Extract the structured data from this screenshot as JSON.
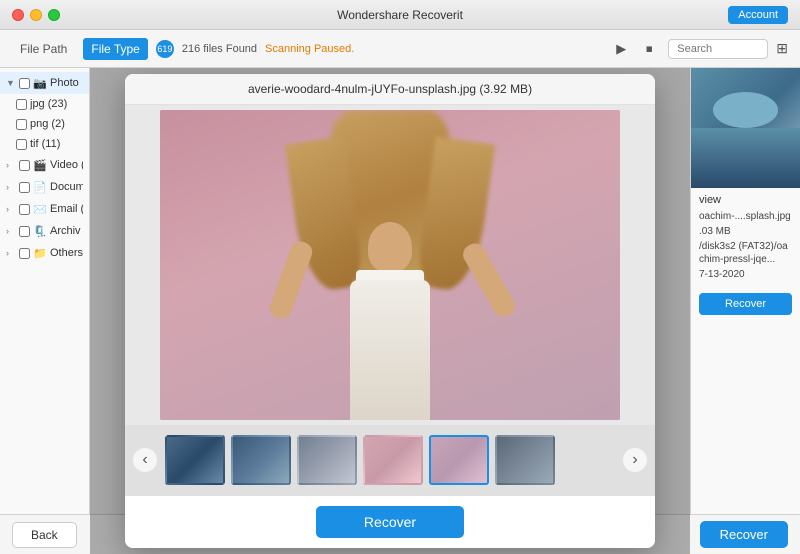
{
  "app": {
    "title": "Wondershare Recoverit",
    "account_label": "Account"
  },
  "toolbar": {
    "file_path_label": "File Path",
    "file_type_label": "File Type",
    "scan_count": "619",
    "files_found": "216 files Found",
    "scanning_status": "Scanning Paused.",
    "search_placeholder": "Search"
  },
  "sidebar": {
    "items": [
      {
        "label": "Photo",
        "expanded": true,
        "checked": false,
        "icon": "📷"
      },
      {
        "label": "jpg (23)",
        "sub": true,
        "checked": false
      },
      {
        "label": "png (2)",
        "sub": true,
        "checked": false
      },
      {
        "label": "tif (11)",
        "sub": true,
        "checked": false
      },
      {
        "label": "Video (",
        "checked": false,
        "icon": "🎬"
      },
      {
        "label": "Docum",
        "checked": false,
        "icon": "📄"
      },
      {
        "label": "Email (",
        "checked": false,
        "icon": "✉️"
      },
      {
        "label": "Archiv",
        "checked": false,
        "icon": "🗜️"
      },
      {
        "label": "Others",
        "checked": false,
        "icon": "📁"
      }
    ]
  },
  "modal": {
    "filename": "averie-woodard-4nulm-jUYFo-unsplash.jpg (3.92 MB)",
    "recover_label": "Recover"
  },
  "right_panel": {
    "preview_label": "view",
    "filename": "oachim-....splash.jpg",
    "size": ".03 MB",
    "path": "/disk3s2 (FAT32)/oachim-pressl-jqe...",
    "date": "7-13-2020",
    "recover_label": "Recover"
  },
  "bottom_bar": {
    "back_label": "Back",
    "recover_label": "Recover"
  },
  "thumbnails": [
    {
      "id": "thumb1",
      "active": false,
      "bg_class": "thumb-bg-1"
    },
    {
      "id": "thumb2",
      "active": false,
      "bg_class": "thumb-bg-2"
    },
    {
      "id": "thumb3",
      "active": false,
      "bg_class": "thumb-bg-3"
    },
    {
      "id": "thumb4",
      "active": false,
      "bg_class": "thumb-bg-4"
    },
    {
      "id": "thumb5",
      "active": true,
      "bg_class": "thumb-bg-5"
    },
    {
      "id": "thumb6",
      "active": false,
      "bg_class": "thumb-bg-6"
    }
  ]
}
